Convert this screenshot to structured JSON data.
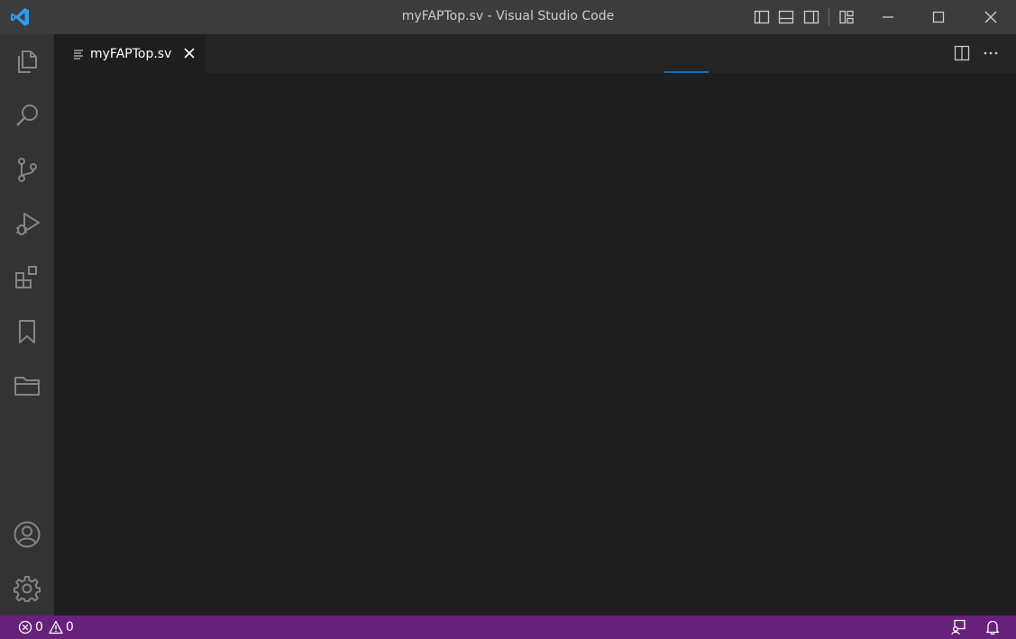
{
  "window": {
    "title": "myFAPTop.sv - Visual Studio Code"
  },
  "tabs": [
    {
      "label": "myFAPTop.sv"
    }
  ],
  "status": {
    "errors": "0",
    "warnings": "0"
  },
  "colors": {
    "titlebar": "#3c3c3c",
    "activitybar": "#333333",
    "editor": "#1e1e1e",
    "statusbar": "#68217a",
    "accent": "#0e70c0"
  },
  "icons": {
    "activity": [
      "explorer-icon",
      "search-icon",
      "source-control-icon",
      "run-debug-icon",
      "extensions-icon",
      "bookmarks-icon",
      "folder-icon",
      "account-icon",
      "settings-gear-icon"
    ]
  }
}
